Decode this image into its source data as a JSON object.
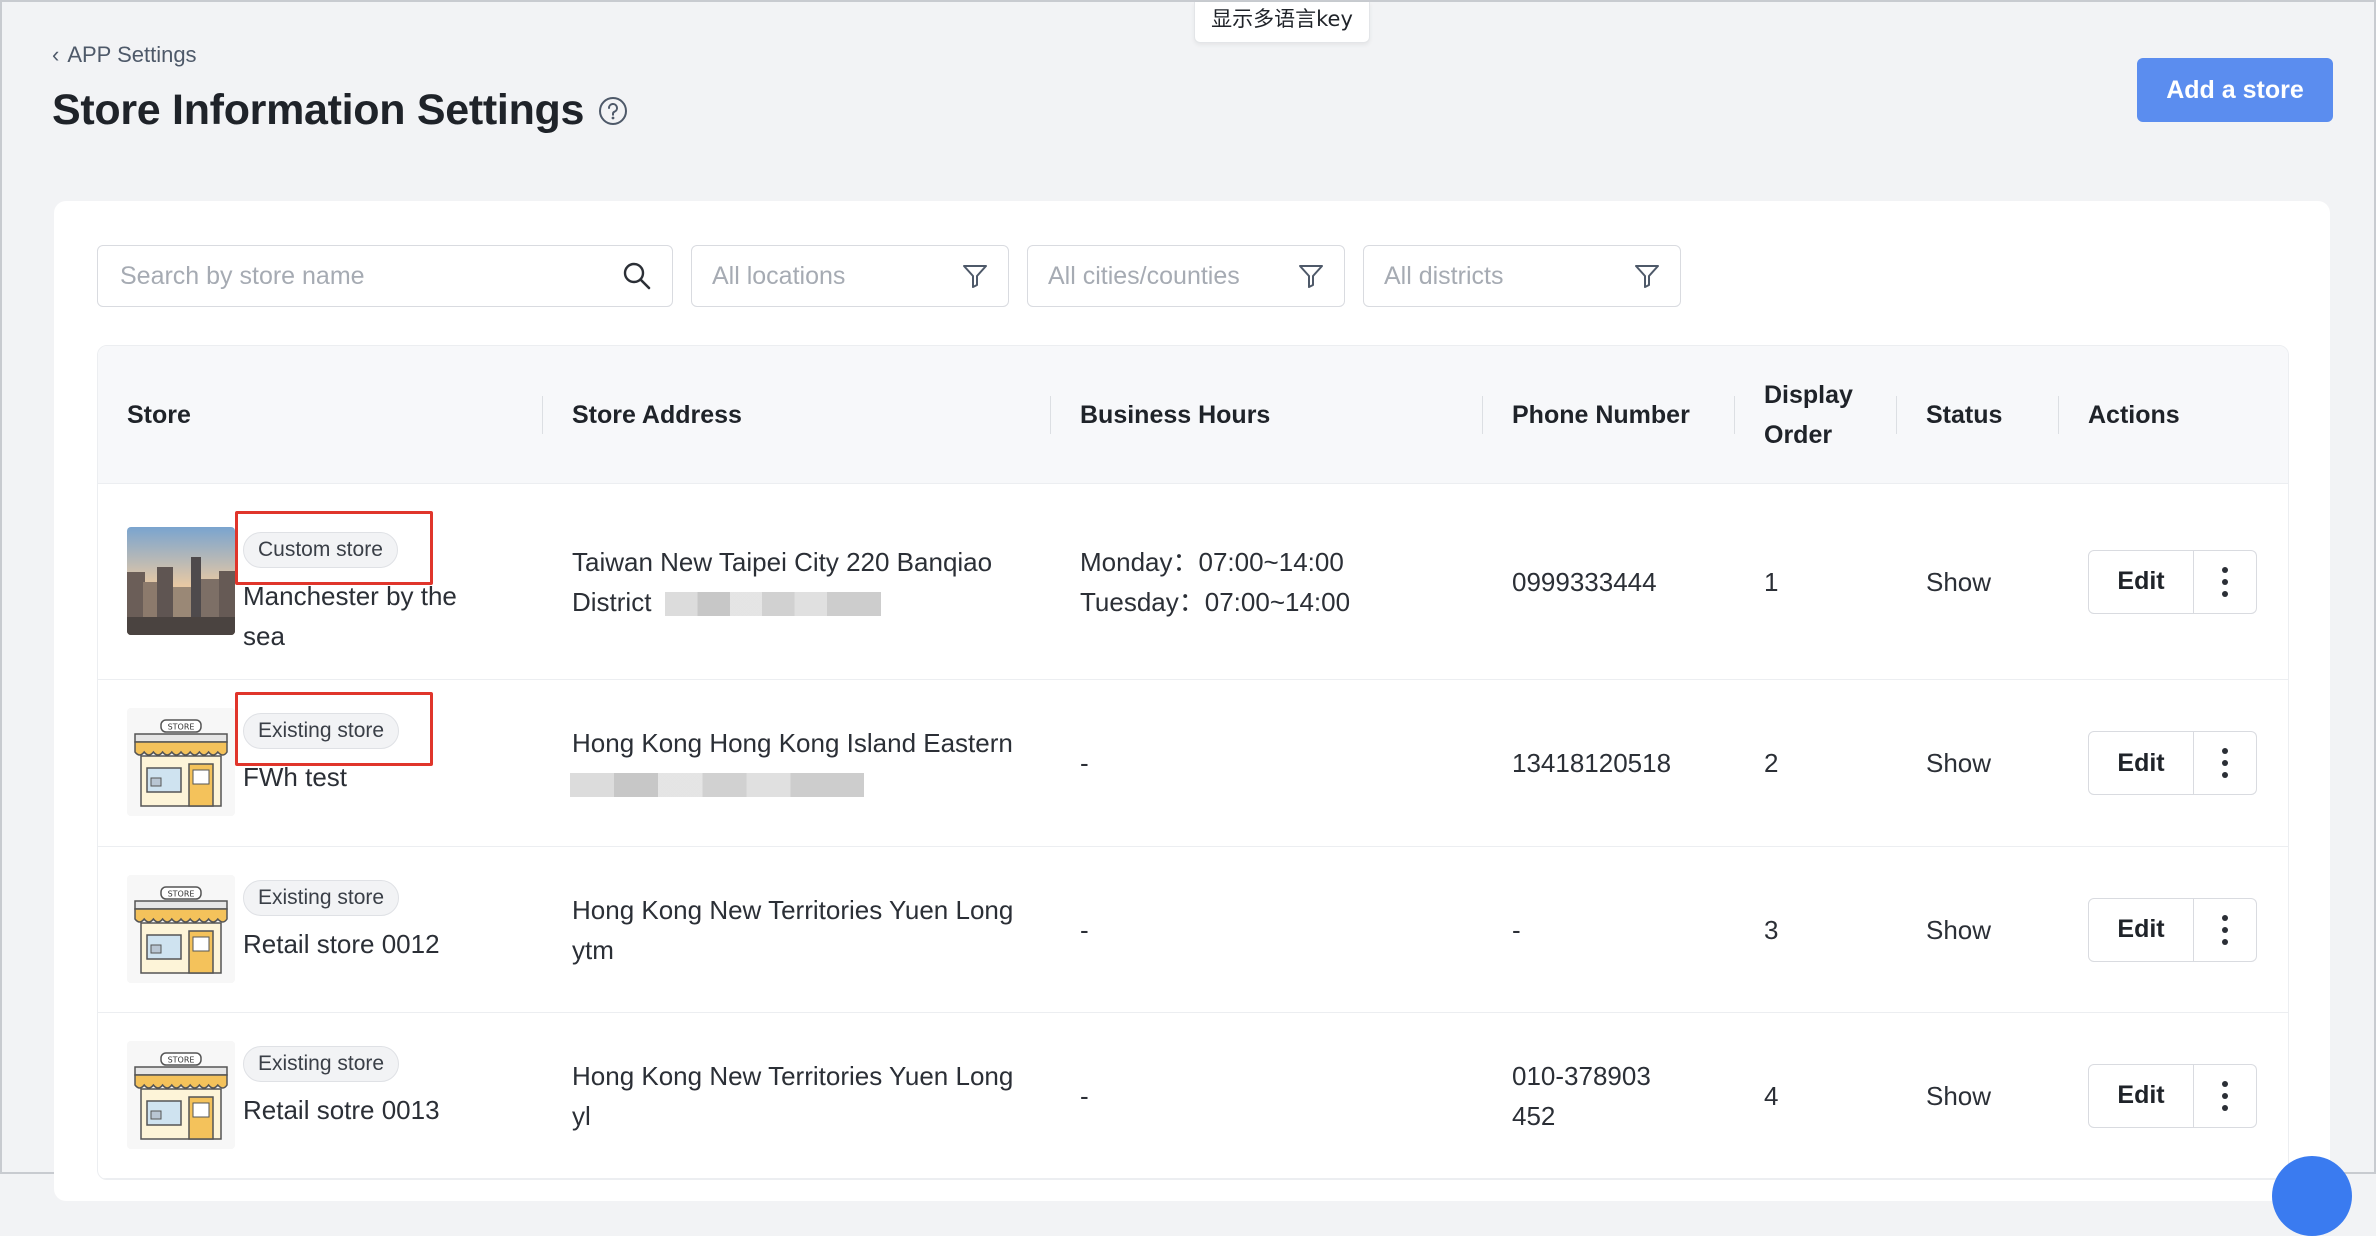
{
  "lang_key": "显示多语言key",
  "breadcrumb": {
    "label": "APP Settings"
  },
  "page": {
    "title": "Store Information Settings"
  },
  "add_button": "Add a store",
  "filters": {
    "search_placeholder": "Search by store name",
    "locations_placeholder": "All locations",
    "cities_placeholder": "All cities/counties",
    "districts_placeholder": "All districts"
  },
  "table": {
    "headers": {
      "store": "Store",
      "address": "Store Address",
      "hours": "Business Hours",
      "phone": "Phone Number",
      "display_order": "Display Order",
      "status": "Status",
      "actions": "Actions"
    },
    "rows": [
      {
        "tag": "Custom store",
        "name": "Manchester by the sea",
        "address": "Taiwan New Taipei City 220 Banqiao District",
        "hours": [
          "Monday：07:00~14:00",
          "Tuesday：07:00~14:00"
        ],
        "phone": "0999333444",
        "order": "1",
        "status": "Show",
        "edit": "Edit"
      },
      {
        "tag": "Existing store",
        "name": "FWh test",
        "address": "Hong Kong Hong Kong Island Eastern",
        "hours": [
          "-"
        ],
        "phone": "13418120518",
        "order": "2",
        "status": "Show",
        "edit": "Edit"
      },
      {
        "tag": "Existing store",
        "name": "Retail store 0012",
        "address": "Hong Kong New Territories Yuen Long ytm",
        "hours": [
          "-"
        ],
        "phone": "-",
        "order": "3",
        "status": "Show",
        "edit": "Edit"
      },
      {
        "tag": "Existing store",
        "name": "Retail sotre 0013",
        "address": "Hong Kong New Territories Yuen Long yl",
        "hours": [
          "-"
        ],
        "phone": "010-378903452",
        "order": "4",
        "status": "Show",
        "edit": "Edit"
      }
    ]
  },
  "colors": {
    "primary": "#5b8def",
    "highlight": "#e0352b",
    "background": "#f2f3f5"
  }
}
